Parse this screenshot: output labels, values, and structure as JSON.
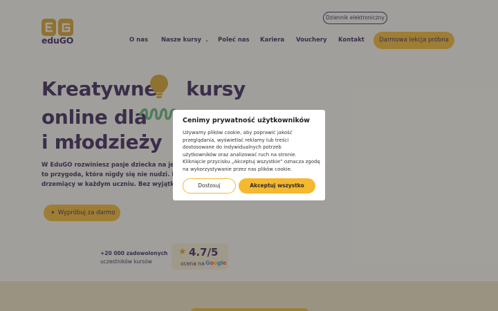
{
  "header": {
    "logo_text": "eduGO",
    "top_pill": "Dziennik elektroniczny",
    "nav": [
      {
        "label": "O nas"
      },
      {
        "label": "Nasze kursy"
      },
      {
        "label": "Poleć nas"
      },
      {
        "label": "Kariera"
      },
      {
        "label": "Vouchery"
      },
      {
        "label": "Kontakt"
      }
    ],
    "cta": "Darmowa lekcja próbna"
  },
  "hero": {
    "title_line1": "Kreatywne",
    "title_line1b": "kursy",
    "title_line2": "online dla",
    "title_line3": "i młodzieży",
    "desc_lines": [
      "W EduGO rozwiniesz pasje dziecka na jego",
      "to przygoda, która nigdy się nie nudzi. Po",
      "drzemiący w każdym uczniu. Bez wyjątku"
    ],
    "try_button": "Wypróbuj za darmo"
  },
  "stats": {
    "count": "+20 000 zadowolonych",
    "count_label": "uczestników kursów",
    "rating": "4.7/5",
    "rating_label": "ocena na",
    "google": "Google"
  },
  "cookie_modal": {
    "title": "Cenimy prywatność użytkowników",
    "body_lines": [
      "Używamy plików cookie, aby poprawić jakość",
      "przeglądania, wyświetlać reklamy lub treści",
      "dostosowane do indywidualnych potrzeb",
      "użytkowników oraz analizować ruch na stronie.",
      "Kliknięcie przycisku „Akceptuj wszystkie” oznacza zgodę",
      "na wykorzystywanie przez nas plików cookie."
    ],
    "customize_button": "Dostosuj",
    "accept_button": "Akceptuj wszystko"
  },
  "colors": {
    "accent": "#f5b82e",
    "brand": "#3a2358",
    "green": "#5fb573"
  }
}
